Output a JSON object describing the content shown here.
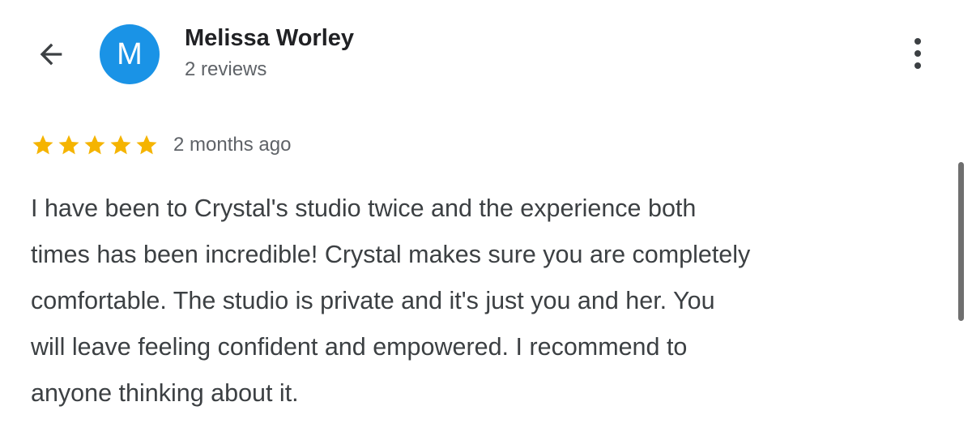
{
  "header": {
    "back_icon": "arrow-back-icon",
    "avatar_letter": "M",
    "avatar_color": "#1a93e6",
    "reviewer_name": "Melissa Worley",
    "review_count": "2 reviews",
    "more_icon": "more-vert-icon"
  },
  "review": {
    "rating": 5,
    "rating_max": 5,
    "star_color": "#f5b400",
    "date": "2 months ago",
    "text_lines": [
      "I have been to Crystal's studio twice and the experience both",
      "times has been incredible! Crystal makes sure you are completely",
      "comfortable. The studio is private and it's just you and her. You",
      "will leave feeling confident and empowered. I recommend to",
      "anyone thinking about it."
    ]
  }
}
